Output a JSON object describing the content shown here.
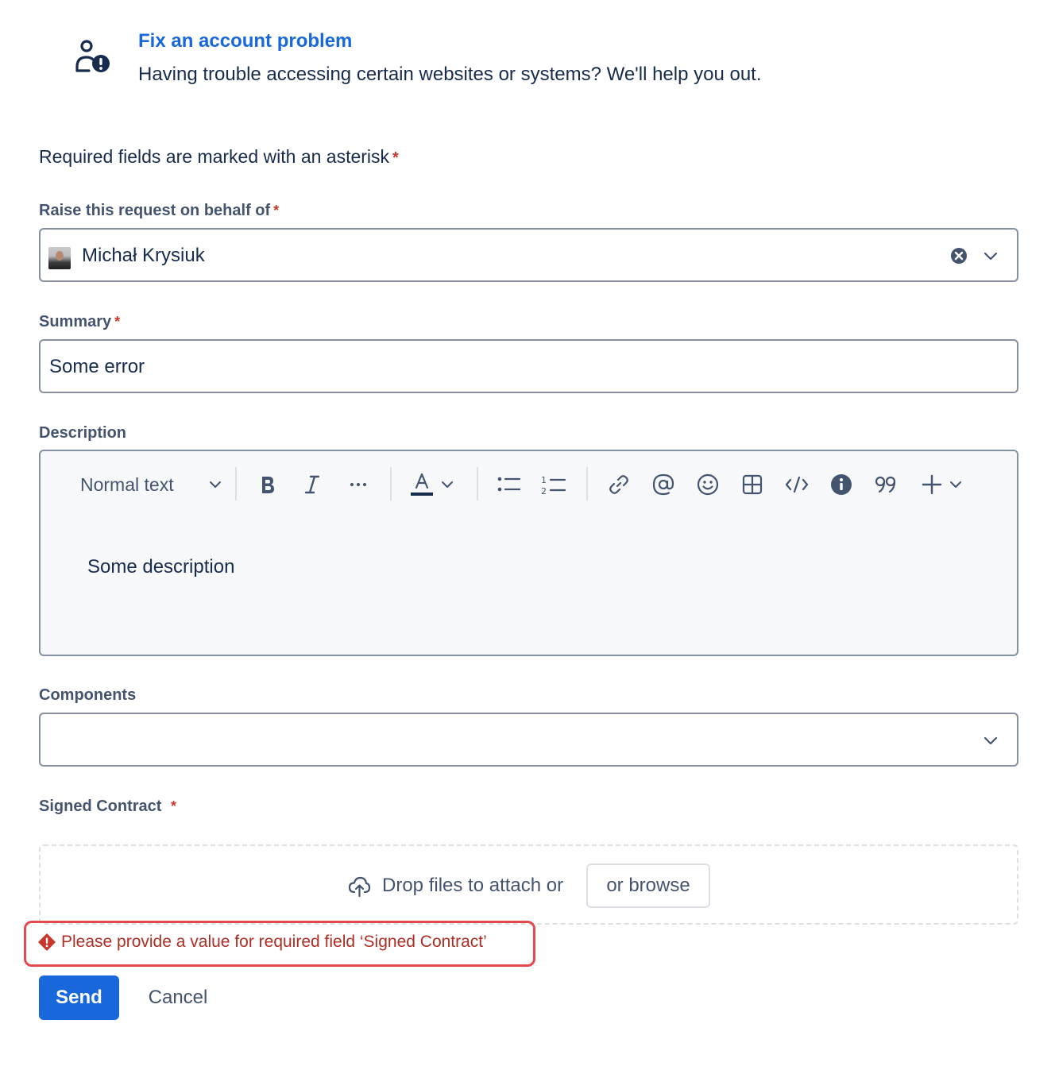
{
  "request_type": {
    "icon": "account-problem-icon",
    "title": "Fix an account problem",
    "description": "Having trouble accessing certain websites or systems? We'll help you out."
  },
  "required_note": "Required fields are marked with an asterisk",
  "asterisk": "*",
  "fields": {
    "on_behalf": {
      "label": "Raise this request on behalf of",
      "value": "Michał Krysiuk"
    },
    "summary": {
      "label": "Summary",
      "value": "Some error"
    },
    "description": {
      "label": "Description",
      "text_style": "Normal text",
      "value": "Some description"
    },
    "components": {
      "label": "Components",
      "value": ""
    },
    "signed_contract": {
      "label": "Signed Contract",
      "drop_text": "Drop files to attach or",
      "browse_label": "or browse"
    }
  },
  "toolbar_icons": [
    "bold-icon",
    "italic-icon",
    "more-formatting-icon",
    "text-color-icon",
    "bullet-list-icon",
    "numbered-list-icon",
    "link-icon",
    "mention-icon",
    "emoji-icon",
    "table-icon",
    "code-icon",
    "info-panel-icon",
    "quote-icon",
    "insert-plus-icon"
  ],
  "error": {
    "message": "Please provide a value for required field ‘Signed Contract’"
  },
  "actions": {
    "send_label": "Send",
    "cancel_label": "Cancel"
  },
  "colors": {
    "link_blue": "#1868db",
    "error_red": "#ae2e24",
    "highlight_red": "#e5484d",
    "text": "#172b4d",
    "subtle_text": "#44546f"
  }
}
